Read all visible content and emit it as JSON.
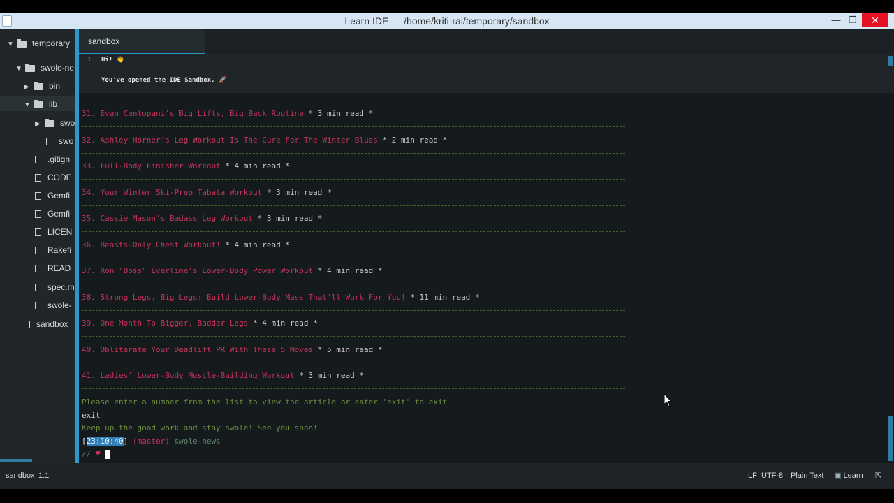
{
  "window": {
    "title": "Learn IDE — /home/kriti-rai/temporary/sandbox",
    "min_glyph": "—",
    "max_glyph": "❐",
    "close_glyph": "✕"
  },
  "tree": {
    "root": "temporary",
    "items": [
      {
        "label": "swole-ne",
        "kind": "folder",
        "expanded": true
      },
      {
        "label": "bin",
        "kind": "folder",
        "expanded": false
      },
      {
        "label": "lib",
        "kind": "folder",
        "expanded": true
      },
      {
        "label": "swo",
        "kind": "folder",
        "expanded": false
      },
      {
        "label": "swo",
        "kind": "file"
      },
      {
        "label": ".gitign",
        "kind": "file"
      },
      {
        "label": "CODE",
        "kind": "file"
      },
      {
        "label": "Gemfi",
        "kind": "file"
      },
      {
        "label": "Gemfi",
        "kind": "file"
      },
      {
        "label": "LICEN",
        "kind": "file"
      },
      {
        "label": "Rakefi",
        "kind": "file"
      },
      {
        "label": "READ",
        "kind": "file"
      },
      {
        "label": "spec.m",
        "kind": "file"
      },
      {
        "label": "swole-",
        "kind": "file"
      },
      {
        "label": "sandbox",
        "kind": "file"
      }
    ]
  },
  "tab": {
    "label": "sandbox"
  },
  "editor": {
    "line_number": "1",
    "line1": "Hi! 👋",
    "line2": "You've opened the IDE Sandbox. 🚀"
  },
  "terminal": {
    "articles": [
      {
        "num": "31.",
        "title": "Evan Centopani's Big Lifts, Big Back Routine",
        "read": " * 3 min read *"
      },
      {
        "num": "32.",
        "title": "Ashley Horner's Leg Workout Is The Cure For The Winter Blues",
        "read": " * 2 min read *"
      },
      {
        "num": "33.",
        "title": "Full-Body Finisher Workout",
        "read": " * 4 min read *"
      },
      {
        "num": "34.",
        "title": "Your Winter Ski-Prep Tabata Workout",
        "read": " * 3 min read *"
      },
      {
        "num": "35.",
        "title": "Cassie Mason's Badass Leg Workout",
        "read": " * 3 min read *"
      },
      {
        "num": "36.",
        "title": "Beasts-Only Chest Workout!",
        "read": " * 4 min read *"
      },
      {
        "num": "37.",
        "title": "Ron \"Boss\" Everline's Lower-Body Power Workout",
        "read": " * 4 min read *"
      },
      {
        "num": "38.",
        "title": "Strong Legs, Big Legs: Build Lower-Body Mass That'll Work For You!",
        "read": " * 11 min read *"
      },
      {
        "num": "39.",
        "title": "One Month To Bigger, Badder Legs",
        "read": " * 4 min read *"
      },
      {
        "num": "40.",
        "title": "Obliterate Your Deadlift PR With These 5 Moves",
        "read": " * 5 min read *"
      },
      {
        "num": "41.",
        "title": "Ladies' Lower-Body Muscle-Building Workout",
        "read": " * 3 min read *"
      }
    ],
    "prompt_text": "Please enter a number from the list to view the article or enter 'exit' to exit",
    "user_input": "exit",
    "farewell": "Keep up the good work and stay swole! See you soon!",
    "ts_open": "[",
    "timestamp": "23:10:40",
    "ts_close": "]",
    "branch": "(master)",
    "project": "swole-news",
    "prompt_symbol": "//",
    "heart": "♥"
  },
  "statusbar": {
    "file": "sandbox",
    "position": "1:1",
    "line_ending": "LF",
    "encoding": "UTF-8",
    "grammar": "Plain Text",
    "learn_label": "Learn",
    "learn_glyph": "▣",
    "popout_glyph": "⇱"
  },
  "colors": {
    "accent": "#2b9ac9",
    "article_title": "#c6335b",
    "prompt_green": "#6e8f3f",
    "terminal_bg": "#151a1d"
  }
}
